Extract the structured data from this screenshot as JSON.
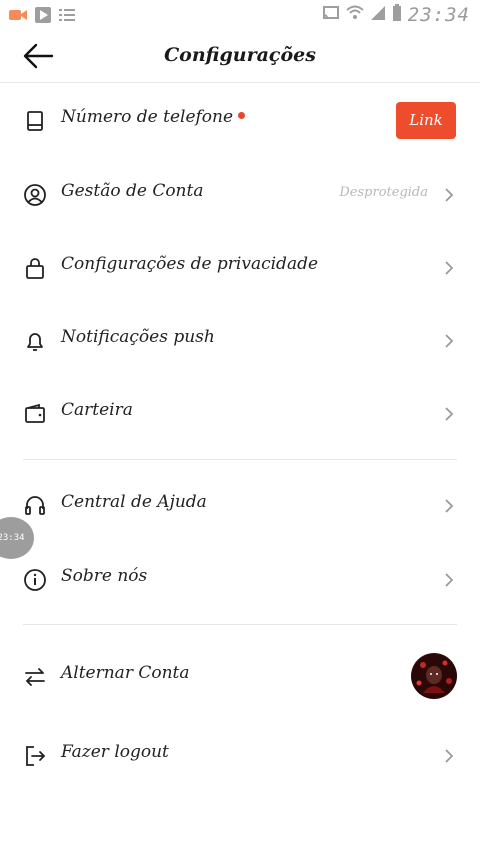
{
  "status_bar": {
    "time": "23:34",
    "colors": {
      "rec": "#f28c5a",
      "play": "#9e9e9e"
    }
  },
  "header": {
    "title": "Configurações"
  },
  "items": [
    {
      "label": "Número de telefone",
      "has_dot": true,
      "button": "Link"
    },
    {
      "label": "Gestão de Conta",
      "sub": "Desprotegida"
    },
    {
      "label": "Configurações de privacidade"
    },
    {
      "label": "Notificações push"
    },
    {
      "label": "Carteira"
    },
    {
      "label": "Central de Ajuda"
    },
    {
      "label": "Sobre nós"
    },
    {
      "label": "Alternar Conta"
    },
    {
      "label": "Fazer logout"
    }
  ],
  "overlay": {
    "bubble_text": "23:34"
  },
  "colors": {
    "accent": "#ee4d2d",
    "dot": "#e8472a"
  }
}
